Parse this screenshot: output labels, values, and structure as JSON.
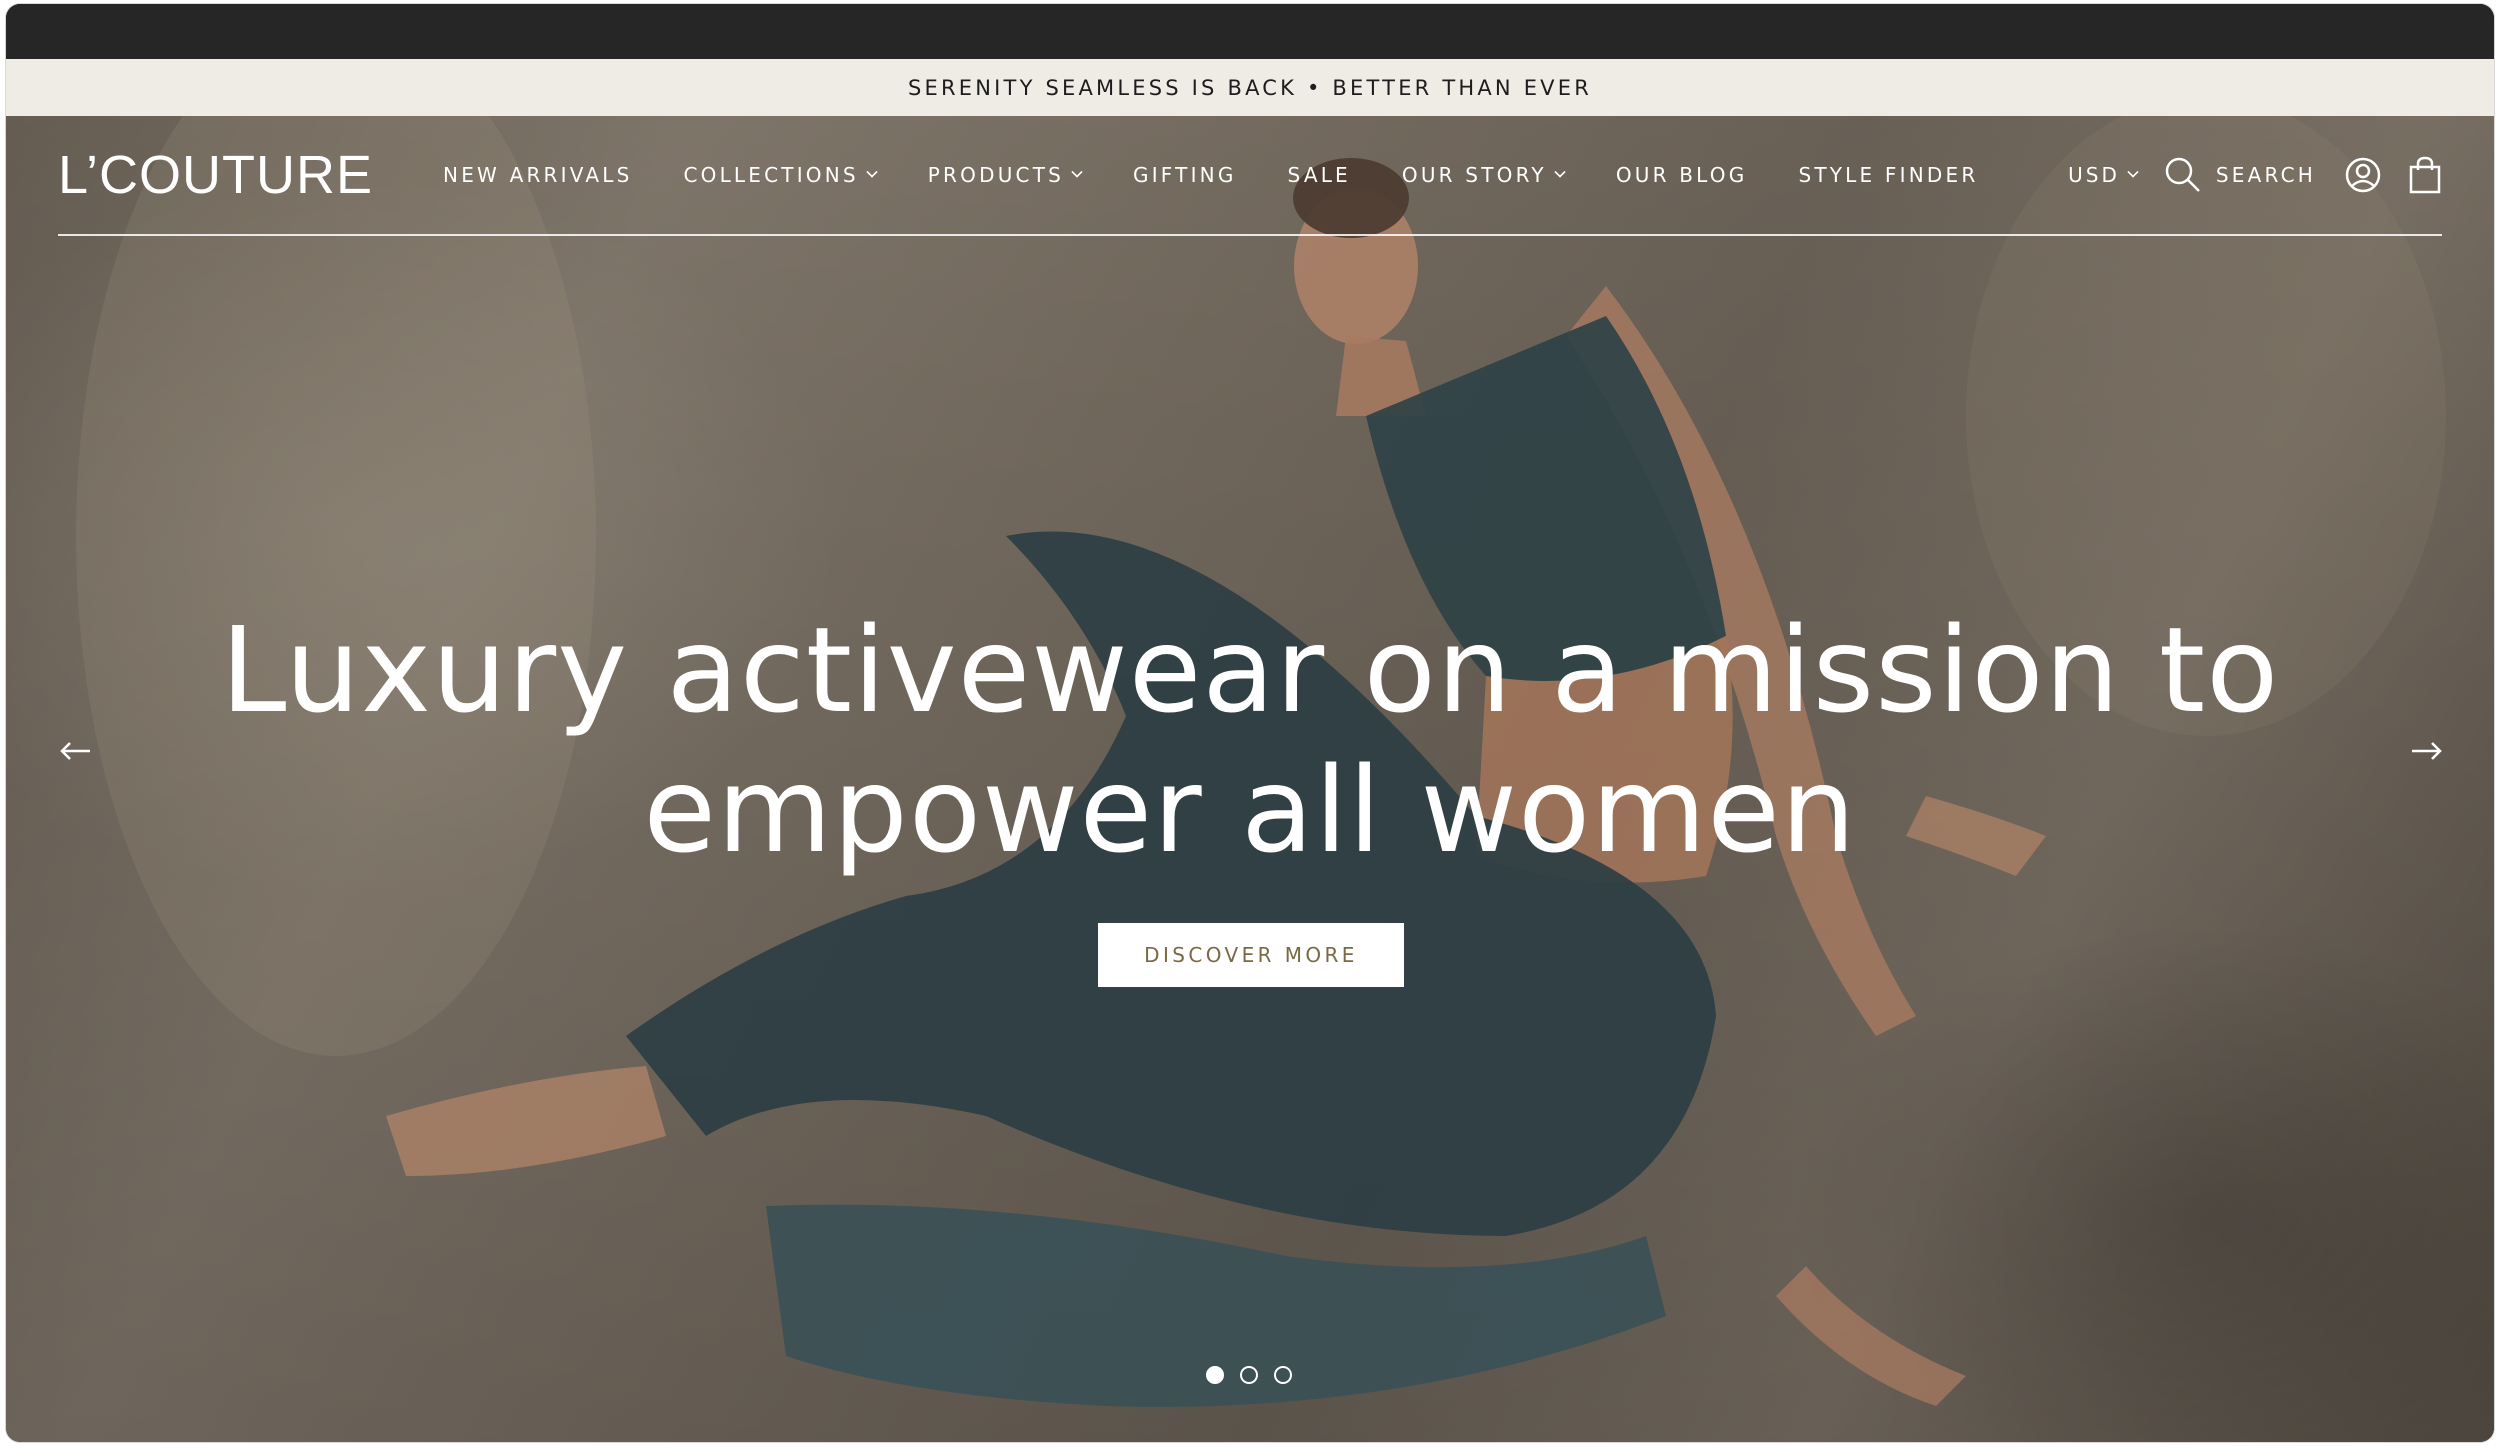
{
  "announcement": "SERENITY SEAMLESS IS BACK • BETTER THAN EVER",
  "header": {
    "logo": "L’COUTURE",
    "menu": [
      {
        "label": "NEW ARRIVALS",
        "dropdown": false
      },
      {
        "label": "COLLECTIONS",
        "dropdown": true
      },
      {
        "label": "PRODUCTS",
        "dropdown": true
      },
      {
        "label": "GIFTING",
        "dropdown": false
      },
      {
        "label": "SALE",
        "dropdown": false
      },
      {
        "label": "OUR STORY",
        "dropdown": true
      },
      {
        "label": "OUR BLOG",
        "dropdown": false
      },
      {
        "label": "STYLE FINDER",
        "dropdown": false
      }
    ],
    "currency": "USD",
    "search_label": "SEARCH",
    "icons": [
      "search-icon",
      "account-icon",
      "shopping-bag-icon"
    ]
  },
  "hero": {
    "headline_line1": "Luxury activewear on a mission to",
    "headline_line2": "empower all women",
    "cta_label": "DISCOVER MORE",
    "slides": 3,
    "active_slide": 0,
    "icons": [
      "arrow-left-icon",
      "arrow-right-icon"
    ]
  },
  "colors": {
    "announcement_bg": "#efece6",
    "cta_text": "#7a6a44",
    "nav_text": "#ffffff"
  }
}
